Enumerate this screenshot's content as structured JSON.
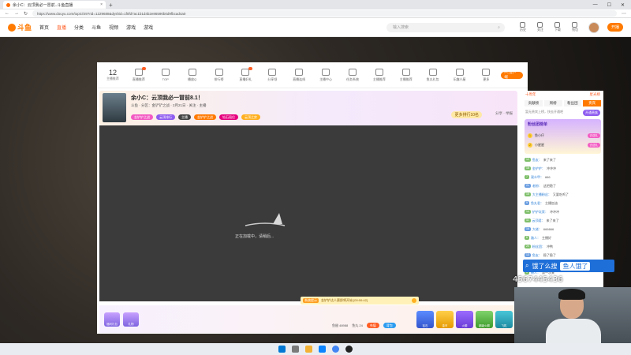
{
  "browser": {
    "tab_title": "余小C：云顶我必一冒前..斗鱼直播",
    "url": "https://www.douyu.com/topic/S9?rid=1229688&dyshid=1f0fd7ac1b1d4b2e86590b0d9fbcad4a0"
  },
  "site": {
    "logo": "斗鱼",
    "nav": [
      "首页",
      "直播",
      "分类",
      "斗鱼",
      "视频",
      "游戏",
      "游戏"
    ],
    "search_placeholder": "输入搜索",
    "icons": [
      "历史",
      "关注",
      "下载",
      "钱包"
    ],
    "open_live": "开播"
  },
  "toolbar": {
    "count": "12",
    "count_label": "主播推荐",
    "items": [
      "直播推荐",
      "TOP",
      "播放Q",
      "排行榜",
      "直播好礼",
      "分享领",
      "直播连线",
      "主播中心",
      "任务系统",
      "主播推荐",
      "主播推荐",
      "鱼丸礼包",
      "乐趣小屋",
      "更多"
    ],
    "pc_button": "PC客户端"
  },
  "room": {
    "title": "余小C：云顶我必一冒前8.1！",
    "subtitle": "斗鱼 · 分区：金铲铲之战 · 2月21日 · 关注 · 主播",
    "tags": [
      "金铲铲之战",
      "云顶排行",
      "主播",
      "金铲铲之战",
      "钻石段位",
      "云顶之弈"
    ],
    "rank_button": "更多排行10名",
    "share": "分享 · 举报"
  },
  "player": {
    "loading_text": "正在加载中，请稍后..."
  },
  "notice": {
    "badge": "系统提示",
    "text": "金铲铲达人赛即将开始 [00:00:42]"
  },
  "giftbar": {
    "left_badges": [
      "福利礼包",
      "礼物"
    ],
    "gifts": [
      "钻石",
      "金币",
      "火箭",
      "超级火箭",
      "飞机"
    ],
    "wallet_label": "鱼翅 48988",
    "fish_label": "鱼丸 24",
    "recharge": "充值",
    "backpack": "背包"
  },
  "sidebar": {
    "tabs": [
      "十周年",
      "星光榜"
    ],
    "subtabs": [
      "贡献榜",
      "周榜",
      "粉丝团",
      "贵宾"
    ],
    "empty_text": "暂无贵宾上榜，快去开通吧",
    "open_btn": "开通贵族",
    "fans_title": "粉丝团榜单",
    "fans_rows": [
      {
        "rank": "1",
        "name": "鱼小仔",
        "pill": "去送礼"
      },
      {
        "rank": "2",
        "name": "小星星",
        "pill": "去送礼"
      }
    ],
    "chat": [
      {
        "lv": "12",
        "name": "鱼友：",
        "text": "来了来了"
      },
      {
        "lv": "18",
        "name": "金铲铲：",
        "text": "冲冲冲"
      },
      {
        "lv": "7",
        "name": "观众甲：",
        "text": "666"
      },
      {
        "lv": "21",
        "name": "老粉：",
        "text": "这把稳了"
      },
      {
        "lv": "15",
        "name": "大主播粉丝：",
        "text": "又要吃鸡了"
      },
      {
        "lv": "9",
        "name": "鱼丸君：",
        "text": "主播加油"
      },
      {
        "lv": "14",
        "name": "铲铲玩家：",
        "text": "冲冲冲"
      },
      {
        "lv": "11",
        "name": "云顶君：",
        "text": "来了来了"
      },
      {
        "lv": "16",
        "name": "大佬：",
        "text": "666666"
      },
      {
        "lv": "8",
        "name": "路人：",
        "text": "主播好"
      },
      {
        "lv": "20",
        "name": "粉丝团：",
        "text": "冲鸭"
      },
      {
        "lv": "13",
        "name": "鱼友：",
        "text": "稳了稳了"
      },
      {
        "lv": "10",
        "name": "观众：",
        "text": "哈哈哈"
      },
      {
        "lv": "6",
        "name": "新人：",
        "text": "第一次来"
      }
    ],
    "input_placeholder": "这里输入聊天内容",
    "send": "发送"
  },
  "overlay": {
    "search_left": "饿了么搜",
    "search_right": "鱼人饿了",
    "number": "4567445436"
  },
  "colors": {
    "brand": "#ff7a00",
    "accent_purple": "#8f5df0",
    "notice_bg": "#fff1b8"
  }
}
